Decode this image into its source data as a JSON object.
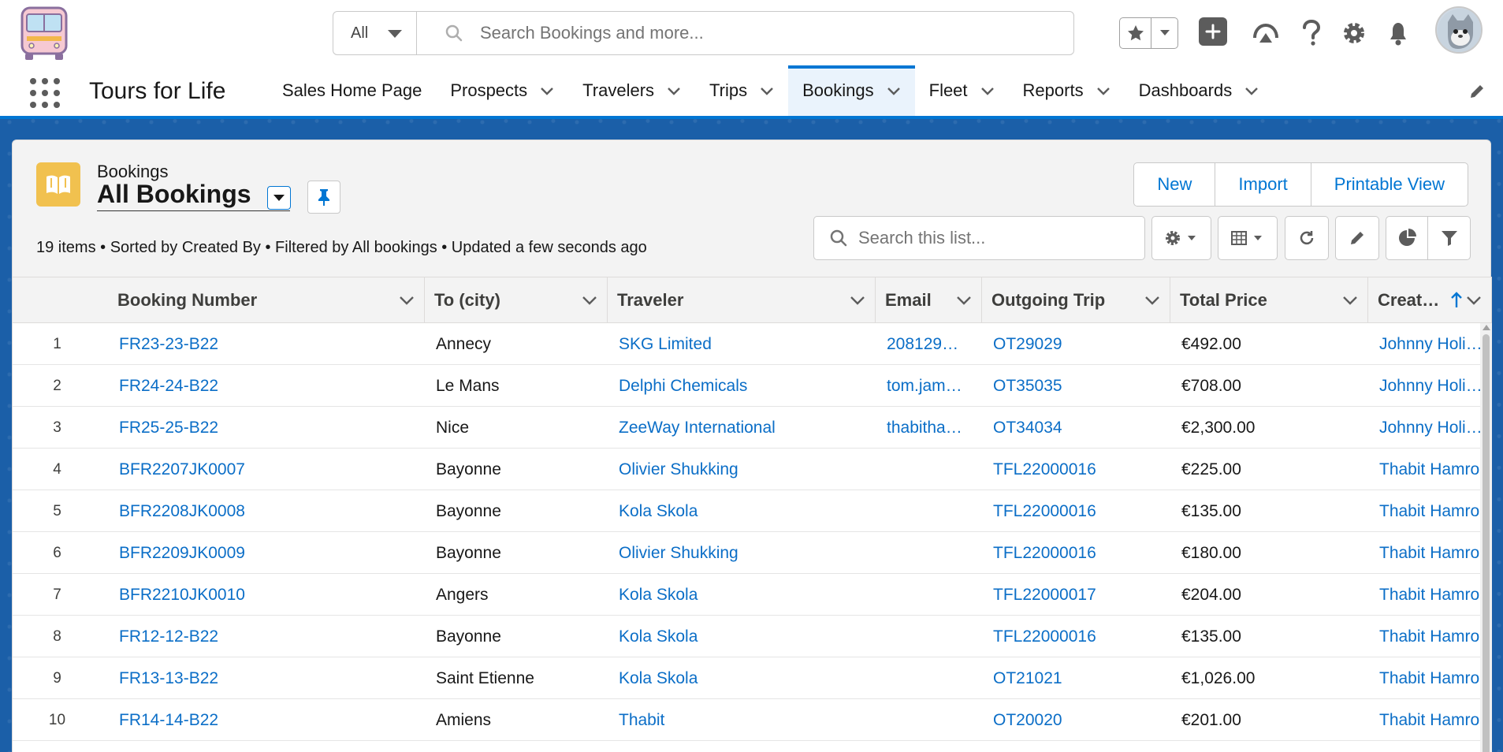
{
  "header": {
    "search_scope": "All",
    "search_placeholder": "Search Bookings and more...",
    "icons": [
      "bus-logo",
      "star-icon",
      "chevron-down-icon",
      "plus-icon",
      "trailhead-icon",
      "help-icon",
      "gear-icon",
      "bell-icon",
      "avatar"
    ]
  },
  "nav": {
    "app_name": "Tours for Life",
    "items": [
      {
        "label": "Sales Home Page",
        "has_menu": false,
        "active": false
      },
      {
        "label": "Prospects",
        "has_menu": true,
        "active": false
      },
      {
        "label": "Travelers",
        "has_menu": true,
        "active": false
      },
      {
        "label": "Trips",
        "has_menu": true,
        "active": false
      },
      {
        "label": "Bookings",
        "has_menu": true,
        "active": true
      },
      {
        "label": "Fleet",
        "has_menu": true,
        "active": false
      },
      {
        "label": "Reports",
        "has_menu": true,
        "active": false
      },
      {
        "label": "Dashboards",
        "has_menu": true,
        "active": false
      }
    ]
  },
  "list": {
    "object_label": "Bookings",
    "view_name": "All Bookings",
    "meta": "19 items • Sorted by Created By • Filtered by All bookings • Updated a few seconds ago",
    "buttons": {
      "new": "New",
      "import": "Import",
      "printable": "Printable View"
    },
    "search_placeholder": "Search this list..."
  },
  "table": {
    "columns": [
      "Booking Number",
      "To (city)",
      "Traveler",
      "Email",
      "Outgoing Trip",
      "Total Price",
      "Creat…"
    ],
    "rows": [
      {
        "n": "1",
        "booking": "FR23-23-B22",
        "city": "Annecy",
        "traveler": "SKG Limited",
        "email": "208129…",
        "trip": "OT29029",
        "price": "€492.00",
        "created": "Johnny Holi…"
      },
      {
        "n": "2",
        "booking": "FR24-24-B22",
        "city": "Le Mans",
        "traveler": "Delphi Chemicals",
        "email": "tom.jam…",
        "trip": "OT35035",
        "price": "€708.00",
        "created": "Johnny Holi…"
      },
      {
        "n": "3",
        "booking": "FR25-25-B22",
        "city": "Nice",
        "traveler": "ZeeWay International",
        "email": "thabitha…",
        "trip": "OT34034",
        "price": "€2,300.00",
        "created": "Johnny Holi…"
      },
      {
        "n": "4",
        "booking": "BFR2207JK0007",
        "city": "Bayonne",
        "traveler": "Olivier Shukking",
        "email": "",
        "trip": "TFL22000016",
        "price": "€225.00",
        "created": "Thabit Hamron"
      },
      {
        "n": "5",
        "booking": "BFR2208JK0008",
        "city": "Bayonne",
        "traveler": "Kola Skola",
        "email": "",
        "trip": "TFL22000016",
        "price": "€135.00",
        "created": "Thabit Hamron"
      },
      {
        "n": "6",
        "booking": "BFR2209JK0009",
        "city": "Bayonne",
        "traveler": "Olivier Shukking",
        "email": "",
        "trip": "TFL22000016",
        "price": "€180.00",
        "created": "Thabit Hamron"
      },
      {
        "n": "7",
        "booking": "BFR2210JK0010",
        "city": "Angers",
        "traveler": "Kola Skola",
        "email": "",
        "trip": "TFL22000017",
        "price": "€204.00",
        "created": "Thabit Hamron"
      },
      {
        "n": "8",
        "booking": "FR12-12-B22",
        "city": "Bayonne",
        "traveler": "Kola Skola",
        "email": "",
        "trip": "TFL22000016",
        "price": "€135.00",
        "created": "Thabit Hamron"
      },
      {
        "n": "9",
        "booking": "FR13-13-B22",
        "city": "Saint Etienne",
        "traveler": "Kola Skola",
        "email": "",
        "trip": "OT21021",
        "price": "€1,026.00",
        "created": "Thabit Hamron"
      },
      {
        "n": "10",
        "booking": "FR14-14-B22",
        "city": "Amiens",
        "traveler": "Thabit",
        "email": "",
        "trip": "OT20020",
        "price": "€201.00",
        "created": "Thabit Hamron"
      }
    ]
  },
  "colors": {
    "brand": "#0176d3",
    "link": "#0b6ec7",
    "object_icon": "#f1c14f",
    "band": "#1b5fa8"
  }
}
